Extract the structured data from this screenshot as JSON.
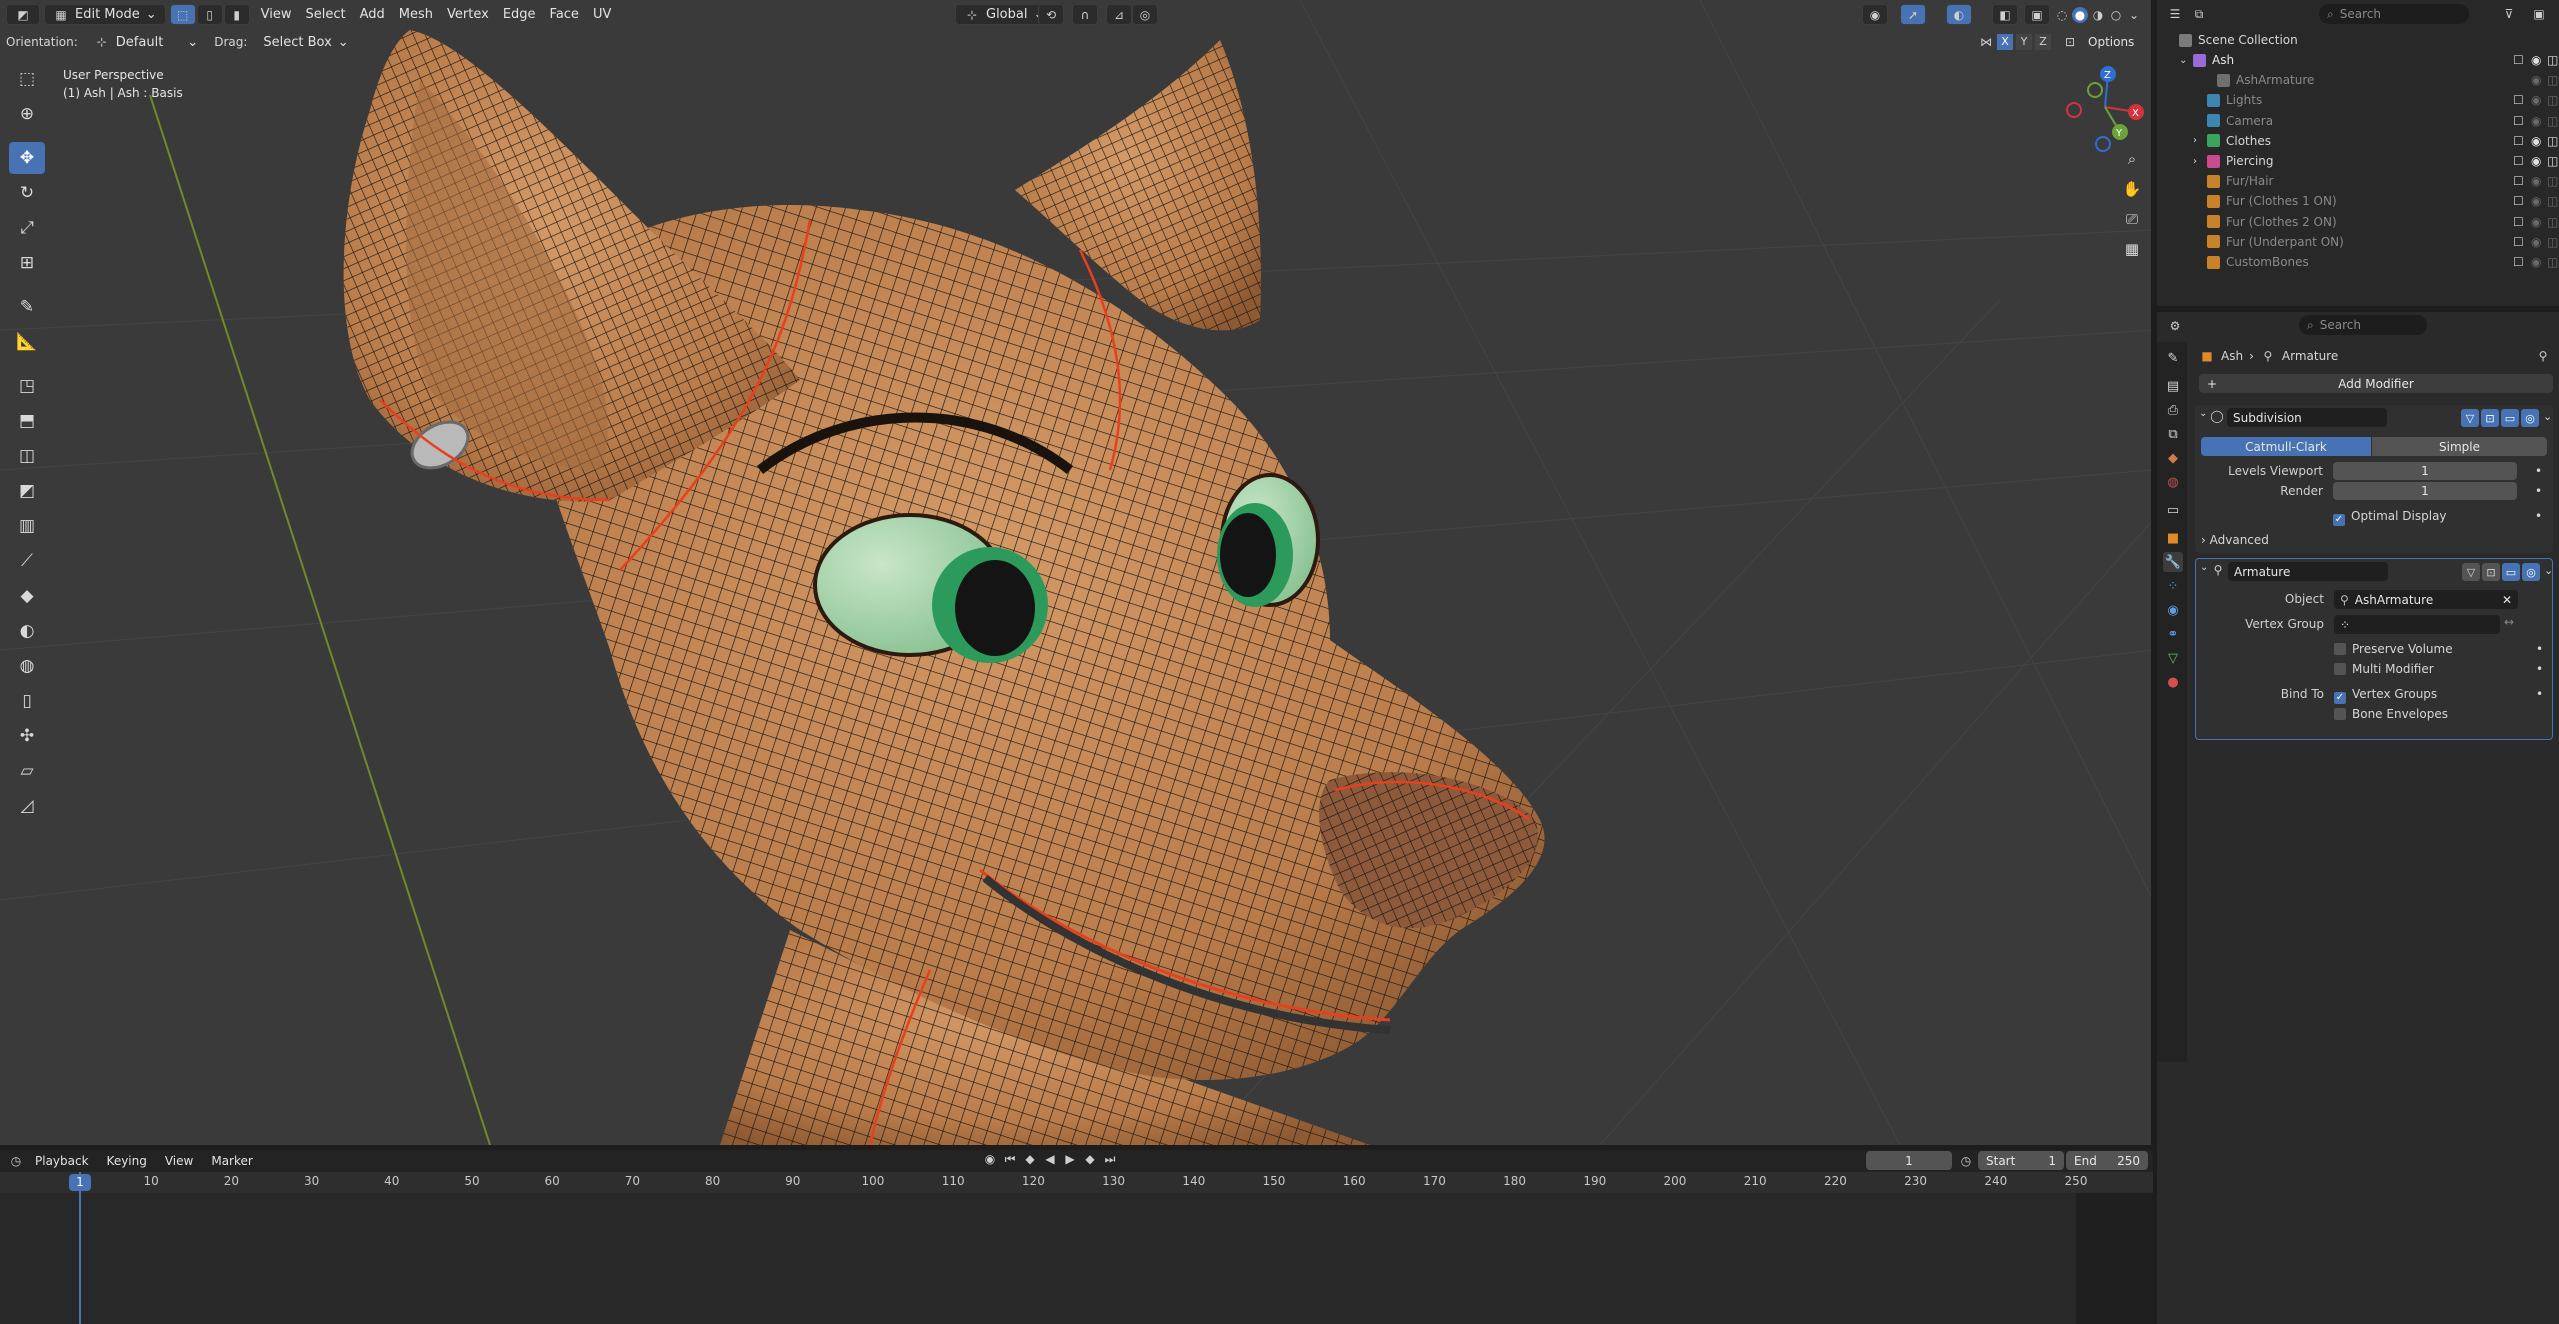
{
  "header": {
    "mode": "Edit Mode",
    "menus": [
      "View",
      "Select",
      "Add",
      "Mesh",
      "Vertex",
      "Edge",
      "Face",
      "UV"
    ],
    "transform_orientation": "Global",
    "options": "Options",
    "axes": [
      "X",
      "Y",
      "Z"
    ]
  },
  "toolsettings": {
    "orientation_label": "Orientation:",
    "orientation_value": "Default",
    "drag_label": "Drag:",
    "drag_value": "Select Box"
  },
  "viewport": {
    "view_name": "User Perspective",
    "object_info": "(1) Ash | Ash : Basis",
    "gizmo_axes": [
      "X",
      "Y",
      "Z"
    ]
  },
  "toolbar_icons": [
    "select-box-icon",
    "cursor-icon",
    "move-icon",
    "rotate-icon",
    "scale-icon",
    "transform-icon",
    "annotate-icon",
    "measure-icon",
    "add-cube-icon",
    "extrude-icon",
    "inset-icon",
    "bevel-icon",
    "loop-cut-icon",
    "knife-icon",
    "poly-build-icon",
    "spin-icon",
    "smooth-icon",
    "edge-slide-icon",
    "shrink-icon",
    "shear-icon",
    "rip-icon"
  ],
  "timeline": {
    "menus": [
      "Playback",
      "Keying",
      "View",
      "Marker"
    ],
    "current_frame": "1",
    "start_label": "Start",
    "start": "1",
    "end_label": "End",
    "end": "250",
    "ruler": [
      "1",
      "10",
      "20",
      "30",
      "40",
      "50",
      "60",
      "70",
      "80",
      "90",
      "100",
      "110",
      "120",
      "130",
      "140",
      "150",
      "160",
      "170",
      "180",
      "190",
      "200",
      "210",
      "220",
      "230",
      "240",
      "250"
    ]
  },
  "outliner": {
    "search_placeholder": "Search",
    "root": "Scene Collection",
    "items": [
      {
        "label": "Ash",
        "color": "#9a6bd8"
      },
      {
        "label": "AshArmature",
        "color": "#6f6f6f"
      },
      {
        "label": "Lights",
        "color": "#3e86b0"
      },
      {
        "label": "Camera",
        "color": "#3e86b0"
      },
      {
        "label": "Clothes",
        "color": "#3aa35c"
      },
      {
        "label": "Piercing",
        "color": "#c84a8f"
      },
      {
        "label": "Fur/Hair",
        "color": "#c8822a"
      },
      {
        "label": "Fur (Clothes 1 ON)",
        "color": "#c8822a"
      },
      {
        "label": "Fur (Clothes 2 ON)",
        "color": "#c8822a"
      },
      {
        "label": "Fur (Underpant ON)",
        "color": "#c8822a"
      },
      {
        "label": "CustomBones",
        "color": "#c8822a"
      }
    ]
  },
  "properties": {
    "search_placeholder": "Search",
    "breadcrumb": [
      "Ash",
      "Armature"
    ],
    "add_modifier": "Add Modifier",
    "subdivision": {
      "name": "Subdivision",
      "types": [
        "Catmull-Clark",
        "Simple"
      ],
      "levels_label": "Levels Viewport",
      "levels": "1",
      "render_label": "Render",
      "render": "1",
      "optimal": "Optimal Display",
      "advanced": "Advanced"
    },
    "armature": {
      "name": "Armature",
      "object_label": "Object",
      "object": "AshArmature",
      "vgroup_label": "Vertex Group",
      "preserve": "Preserve Volume",
      "multi": "Multi Modifier",
      "bind_label": "Bind To",
      "vgroups": "Vertex Groups",
      "envelopes": "Bone Envelopes"
    }
  },
  "colors": {
    "accent": "#4772b3",
    "skin": "#c98e5c",
    "wire": "#141414",
    "seam": "#e8401e",
    "eye": "#9fd2a4",
    "iris": "#2c9a5a"
  }
}
